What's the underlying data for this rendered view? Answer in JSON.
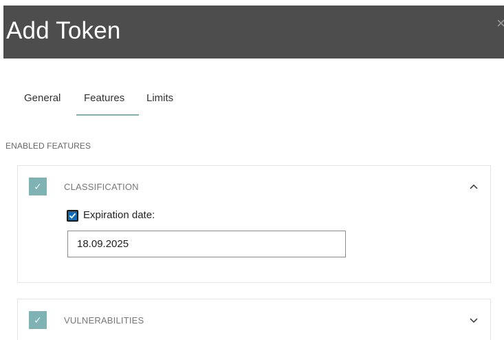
{
  "dialog": {
    "title": "Add Token",
    "close_glyph": "×"
  },
  "tabs": [
    {
      "label": "General",
      "active": false
    },
    {
      "label": "Features",
      "active": true
    },
    {
      "label": "Limits",
      "active": false
    }
  ],
  "section_label": "ENABLED FEATURES",
  "features": [
    {
      "name": "CLASSIFICATION",
      "checked": true,
      "expanded": true,
      "expiration": {
        "label": "Expiration date:",
        "checked": true,
        "value": "18.09.2025"
      }
    },
    {
      "name": "VULNERABILITIES",
      "checked": true,
      "expanded": false
    }
  ],
  "icons": {
    "check_glyph": "✓",
    "chevron_up": "chevron-up-icon",
    "chevron_down": "chevron-down-icon"
  },
  "colors": {
    "titlebar": "#4d4d4d",
    "accent": "#7fb3b3",
    "checkbox_blue": "#0f6cbd"
  }
}
